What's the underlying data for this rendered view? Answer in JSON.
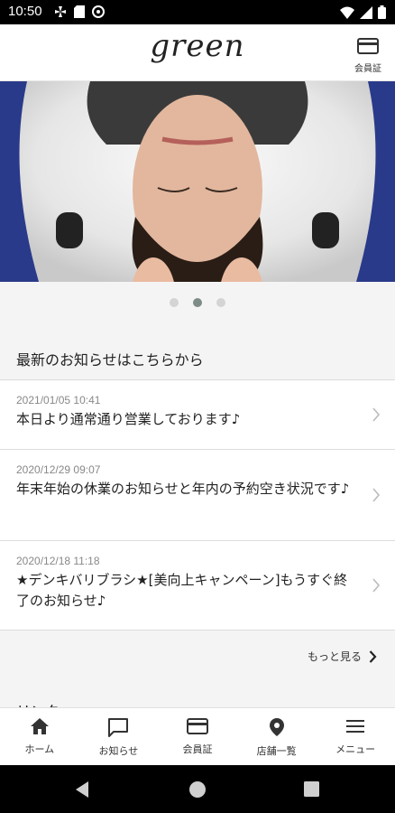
{
  "status_bar": {
    "time": "10:50",
    "left_icons": [
      "fan-icon",
      "sd-card-icon",
      "vpn-icon"
    ],
    "right_icons": [
      "wifi-icon",
      "cellular-icon",
      "battery-icon"
    ]
  },
  "header": {
    "logo_text": "green",
    "member_card_label": "会員証"
  },
  "carousel": {
    "slide_count": 3,
    "active_index": 1
  },
  "news": {
    "section_title": "最新のお知らせはこちらから",
    "items": [
      {
        "date": "2021/01/05 10:41",
        "title": "本日より通常通り営業しております♪"
      },
      {
        "date": "2020/12/29 09:07",
        "title": "年末年始の休業のお知らせと年内の予約空き状況です♪"
      },
      {
        "date": "2020/12/18 11:18",
        "title": "★デンキバリブラシ★[美向上キャンペーン]もうすぐ終了のお知らせ♪"
      }
    ],
    "more_label": "もっと見る"
  },
  "next_section_partial": "リンク",
  "tab_bar": {
    "items": [
      {
        "label": "ホーム",
        "icon": "home-icon"
      },
      {
        "label": "お知らせ",
        "icon": "chat-icon"
      },
      {
        "label": "会員証",
        "icon": "card-icon"
      },
      {
        "label": "店舗一覧",
        "icon": "location-pin-icon"
      },
      {
        "label": "メニュー",
        "icon": "hamburger-icon"
      }
    ]
  },
  "colors": {
    "active_dot": "#7f8c86",
    "hero_background": "#2a3a8a"
  }
}
